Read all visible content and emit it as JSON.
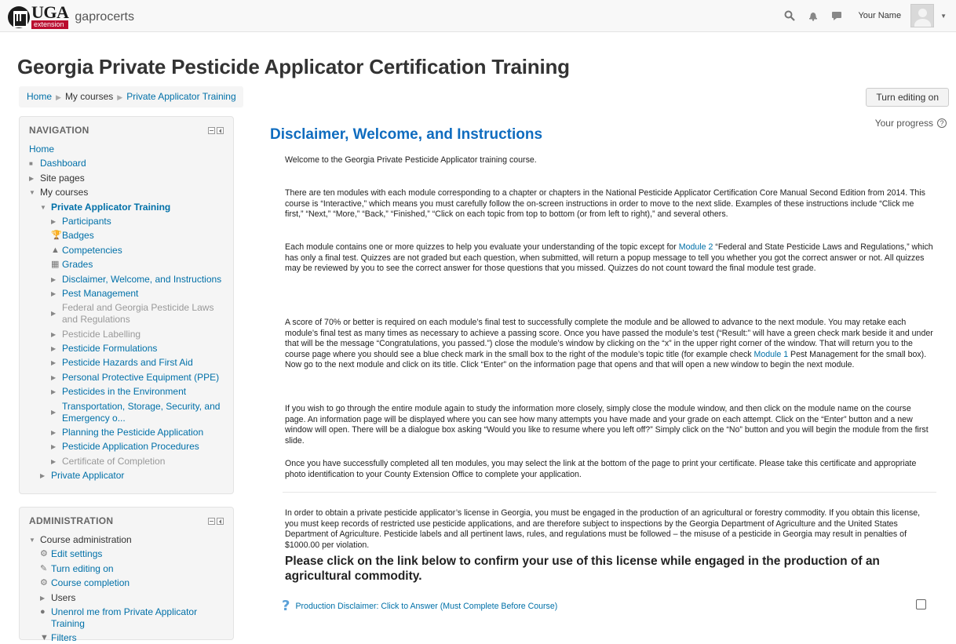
{
  "navbar": {
    "logo_main": "UGA",
    "logo_sub": "extension",
    "site_name": "gaprocerts",
    "icons": [
      "search-icon",
      "notifications-icon",
      "messages-icon"
    ],
    "user_name": "Your Name"
  },
  "page": {
    "title": "Georgia Private Pesticide Applicator Certification Training",
    "edit_button": "Turn editing on",
    "progress_label": "Your progress"
  },
  "breadcrumb": {
    "home": "Home",
    "my_courses": "My courses",
    "current": "Private Applicator Training"
  },
  "navigation": {
    "title": "NAVIGATION",
    "home": "Home",
    "dashboard": "Dashboard",
    "site_pages": "Site pages",
    "my_courses": "My courses",
    "course": "Private Applicator Training",
    "participants": "Participants",
    "badges": "Badges",
    "competencies": "Competencies",
    "grades": "Grades",
    "topics": [
      "Disclaimer, Welcome, and Instructions",
      "Pest Management",
      "Federal and Georgia Pesticide Laws and Regulations",
      "Pesticide Labelling",
      "Pesticide Formulations",
      "Pesticide Hazards and First Aid",
      "Personal Protective Equipment (PPE)",
      "Pesticides in the Environment",
      "Transportation, Storage, Security, and Emergency o...",
      "Planning the Pesticide Application",
      "Pesticide Application Procedures",
      "Certificate of Completion"
    ],
    "private_applicator": "Private Applicator"
  },
  "administration": {
    "title": "ADMINISTRATION",
    "course_admin": "Course administration",
    "edit_settings": "Edit settings",
    "turn_editing_on": "Turn editing on",
    "course_completion": "Course completion",
    "users": "Users",
    "unenrol": "Unenrol me from Private Applicator Training",
    "filters": "Filters"
  },
  "section": {
    "title": "Disclaimer, Welcome, and Instructions",
    "welcome": "Welcome to the Georgia Private Pesticide Applicator training course.",
    "p1": "There are ten modules with each module corresponding to a chapter or chapters in the National Pesticide Applicator Certification Core Manual Second Edition from 2014.  This course is “Interactive,” which means you must carefully follow the on-screen instructions in order to move to the next slide.  Examples of these instructions include “Click me first,” “Next,” “More,” “Back,” “Finished,” “Click on each topic from top to bottom (or from left to right),” and several others.",
    "p2_a": "Each module contains one or more quizzes to help you evaluate your understanding of the topic except for ",
    "p2_link": "Module 2",
    "p2_b": " “Federal and State Pesticide Laws and Regulations,” which has only a final test.  Quizzes are not graded but each question, when submitted, will return a popup message to tell you whether you got the correct answer or not.  All quizzes may be reviewed by you to see the correct answer for those questions that you missed.  Quizzes do not count toward the final module test grade.",
    "p3_a": "A score of 70% or better is required on each module’s final test to successfully complete the module and be allowed to advance to the next module.  You may retake each module’s final test as many times as necessary to achieve a passing score.  Once you have passed the module’s test (“Result:” will have a green check mark beside it and under that will be the message “Congratulations, you passed.”) close the module’s window by clicking on the “x” in the upper right corner of the window.  That will return you to the course page where you should see a blue check mark in the small box to the right of the module’s topic title (for example check ",
    "p3_link": "Module 1",
    "p3_b": " Pest Management for the small box).  Now go to the next module and click on its title.  Click “Enter” on the information page that opens and that will open a new window to begin the next module.",
    "p4": "If you wish to go through the entire module again to study the information more closely, simply close the module window, and then click on the module name on the course page.  An information page will be displayed where you can see how many attempts you have made and your grade on each attempt.  Click on the “Enter” button and a new window will open.  There will be a dialogue box asking “Would you like to resume where you left off?”  Simply click on the “No” button and you will begin the module from the first slide.",
    "p5": "Once you have successfully completed all ten modules, you may select the link at the bottom of the page to print your certificate.  Please take this certificate and appropriate photo identification to your County Extension Office to complete your application.",
    "p6": "In order to obtain a private pesticide applicator’s license in Georgia, you must be engaged in the production of an agricultural or forestry commodity. If you obtain this license, you must keep records of restricted use pesticide applications, and are therefore subject to inspections by the Georgia Department of Agriculture and the United States Department of Agriculture. Pesticide labels and all pertinent laws, rules, and regulations must be followed – the misuse of a pesticide in Georgia may result in penalties of $1000.00 per violation.",
    "confirm_heading": "Please click on the link below to confirm your use of this license while engaged in the production of an agricultural commodity.",
    "disclaimer_link": "Production Disclaimer: Click to Answer (Must Complete Before Course)"
  },
  "colors": {
    "link": "#0070a8",
    "section_title": "#0f6cbf",
    "brand_red": "#ba0c2f",
    "block_bg": "#f5f5f5"
  }
}
